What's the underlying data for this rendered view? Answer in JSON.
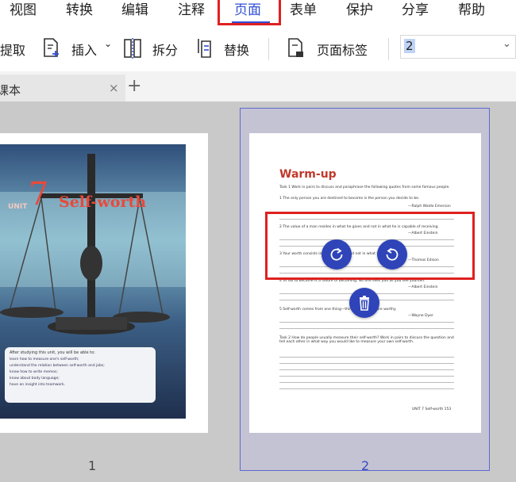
{
  "menu": {
    "items": [
      {
        "label": "视图"
      },
      {
        "label": "转换"
      },
      {
        "label": "编辑"
      },
      {
        "label": "注释"
      },
      {
        "label": "页面"
      },
      {
        "label": "表单"
      },
      {
        "label": "保护"
      },
      {
        "label": "分享"
      },
      {
        "label": "帮助"
      }
    ],
    "active_index": 4
  },
  "toolbar": {
    "extract_label": "提取",
    "insert_label": "插入",
    "insert_arrow": "⌄",
    "split_label": "拆分",
    "replace_label": "替换",
    "page_labels_label": "页面标签",
    "page_number_value": "2",
    "page_number_arrow": "⌄"
  },
  "tabs": {
    "document_label": "课本",
    "close_glyph": "×",
    "add_glyph": "+"
  },
  "thumbnails": {
    "selected_index": 2,
    "pages": [
      {
        "number": "1",
        "unit_label": "UNIT",
        "unit_number": "7",
        "unit_title": "Self-worth",
        "objectives_title": "After studying this unit, you will be able to:",
        "objectives": [
          "learn how to measure one's self-worth;",
          "understand the relation between self-worth and jobs;",
          "know how to write memos;",
          "know about body language;",
          "have an insight into teamwork."
        ]
      },
      {
        "number": "2",
        "heading": "Warm-up",
        "task1": "Task 1  Work in pairs to discuss and paraphrase the following quotes from some famous people.",
        "quotes": [
          "1  The only person you are destined to become is the person you decide to be.",
          "2  The value of a man resides in what he gives and not in what he is capable of receiving.",
          "3  Your worth consists in what you are and not in what you have.",
          "4  To fail to become is a failure of becoming. No one sees you as you see yourself.",
          "5  Self-worth comes from one thing—thinking that you are worthy."
        ],
        "authors": [
          "—Ralph Waldo Emerson",
          "—Albert Einstein",
          "—Thomas Edison",
          "—Albert Einstein",
          "—Wayne Dyer"
        ],
        "task2": "Task 2  How do people usually measure their self-worth? Work in pairs to discuss the question and tell each other in what way you would like to measure your own self-worth.",
        "footer": "UNIT 7  Self-worth  153"
      }
    ],
    "actions": {
      "rotate_left": "rotate-left-icon",
      "rotate_right": "rotate-right-icon",
      "delete": "trash-icon"
    }
  },
  "colors": {
    "accent": "#2f4fd6",
    "highlight": "#e02020",
    "action_button": "#2e44b8"
  }
}
